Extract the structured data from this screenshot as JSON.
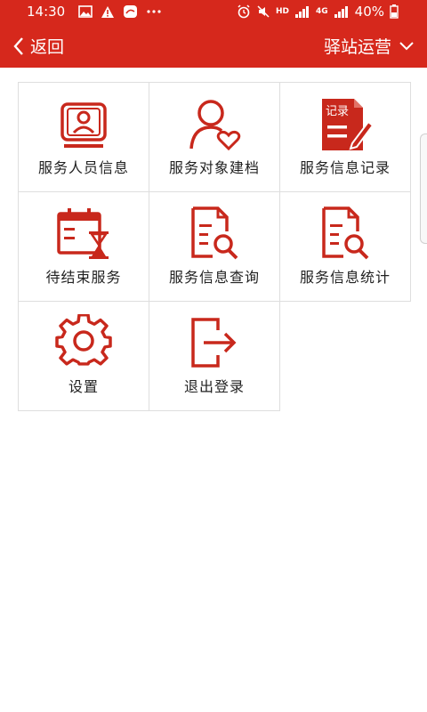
{
  "status_bar": {
    "time": "14:30",
    "battery": "40%",
    "hd": "HD",
    "net": "4G",
    "left_icons": [
      "image-icon",
      "warning-icon",
      "app-notification-icon",
      "more-icon"
    ],
    "right_icons": [
      "alarm-icon",
      "mute-icon",
      "signal-icon",
      "battery-icon"
    ]
  },
  "header": {
    "back_label": "返回",
    "station_label": "驿站运营"
  },
  "menu": {
    "items": [
      {
        "label": "服务人员信息",
        "icon": "staff-card-icon"
      },
      {
        "label": "服务对象建档",
        "icon": "person-heart-icon"
      },
      {
        "label": "服务信息记录",
        "icon": "record-doc-icon",
        "badge": "记录"
      },
      {
        "label": "待结束服务",
        "icon": "calendar-hourglass-icon"
      },
      {
        "label": "服务信息查询",
        "icon": "doc-search-icon"
      },
      {
        "label": "服务信息统计",
        "icon": "doc-stats-icon"
      },
      {
        "label": "设置",
        "icon": "gear-icon"
      },
      {
        "label": "退出登录",
        "icon": "logout-icon"
      }
    ]
  },
  "colors": {
    "brand": "#d6281c",
    "icon": "#c8281c"
  }
}
